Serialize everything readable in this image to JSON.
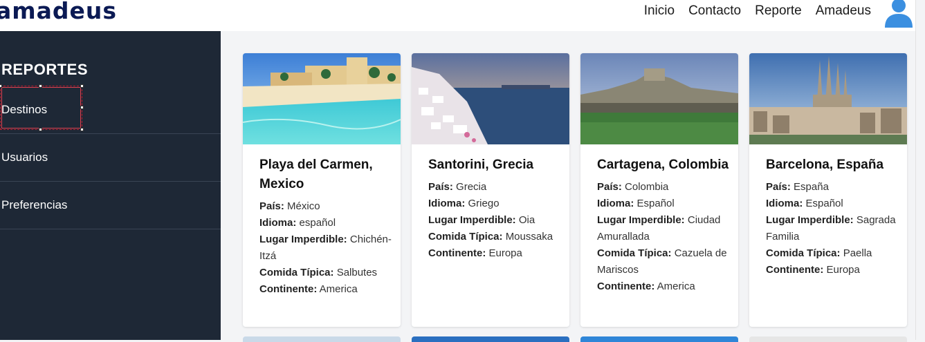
{
  "header": {
    "logo": "amadeus",
    "nav": [
      "Inicio",
      "Contacto",
      "Reporte",
      "Amadeus"
    ]
  },
  "sidebar": {
    "title": "REPORTES",
    "items": [
      {
        "label": "Destinos"
      },
      {
        "label": "Usuarios"
      },
      {
        "label": "Preferencias"
      }
    ]
  },
  "labels": {
    "pais": "País:",
    "idioma": "Idioma:",
    "lugar": "Lugar Imperdible:",
    "comida": "Comida Típica:",
    "continente": "Continente:"
  },
  "cards": [
    {
      "title": "Playa del Carmen, Mexico",
      "pais": "México",
      "idioma": "español",
      "lugar": "Chichén-Itzá",
      "comida": "Salbutes",
      "continente": "America"
    },
    {
      "title": "Santorini, Grecia",
      "pais": "Grecia",
      "idioma": "Griego",
      "lugar": "Oia",
      "comida": "Moussaka",
      "continente": "Europa"
    },
    {
      "title": "Cartagena, Colombia",
      "pais": "Colombia",
      "idioma": "Español",
      "lugar": "Ciudad Amurallada",
      "comida": "Cazuela de Mariscos",
      "continente": "America"
    },
    {
      "title": "Barcelona, España",
      "pais": "España",
      "idioma": "Español",
      "lugar": "Sagrada Familia",
      "comida": "Paella",
      "continente": "Europa"
    }
  ],
  "colors": {
    "sidebar_bg": "#1e2836",
    "logo": "#0b1a54",
    "avatar": "#3b8fe0"
  },
  "icons": {
    "avatar": "user-icon"
  }
}
